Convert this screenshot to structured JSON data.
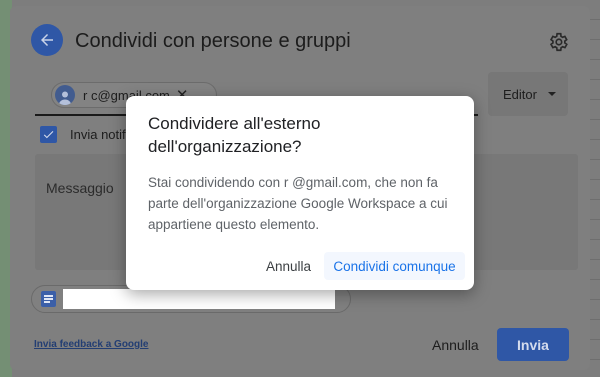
{
  "share_dialog": {
    "title": "Condividi con persone e gruppi",
    "recipient_email": "r       c@gmail.com",
    "role_label": "Editor",
    "notify_label": "Invia notifica",
    "message_placeholder": "Messaggio",
    "feedback_link": "Invia feedback a Google",
    "cancel_label": "Annulla",
    "send_label": "Invia"
  },
  "confirm_dialog": {
    "title": "Condividere all'esterno dell'organizzazione?",
    "body": "Stai condividendo con r          @gmail.com, che non fa parte dell'organizzazione Google Workspace a cui appartiene questo elemento.",
    "cancel_label": "Annulla",
    "confirm_label": "Condividi comunque"
  },
  "colors": {
    "accent": "#1a73e8",
    "primary_button": "#2f57a6"
  }
}
